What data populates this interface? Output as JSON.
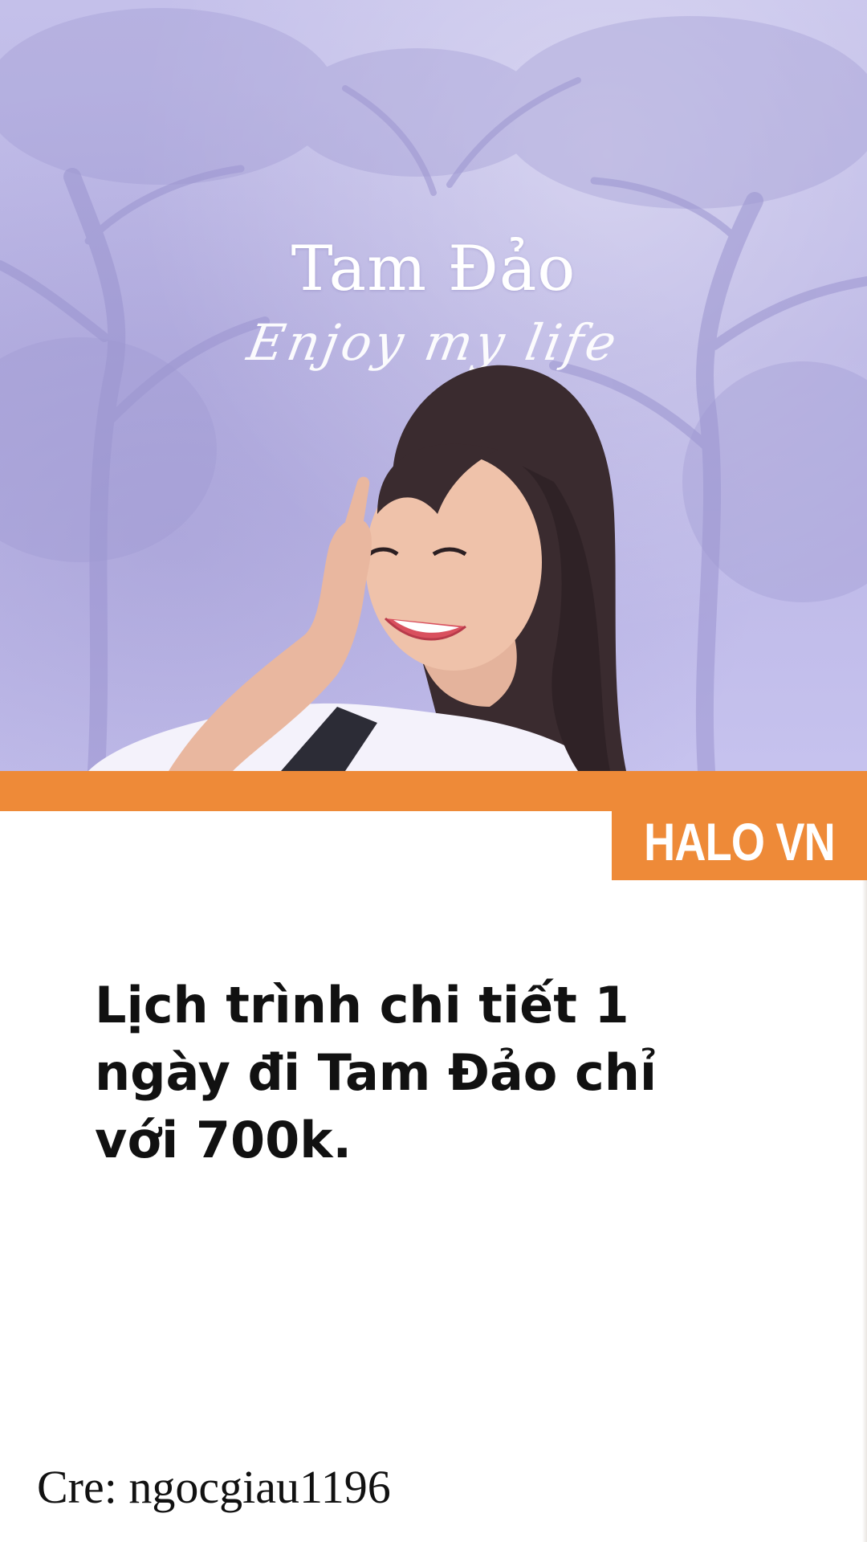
{
  "hero": {
    "title": "Tam Đảo",
    "subtitle": "Enjoy my life"
  },
  "brand": {
    "name": "HALO VN",
    "accent_color": "#ee8a38"
  },
  "headline": {
    "lines": [
      "Lịch trình chi tiết 1",
      "ngày đi Tam Đảo chỉ",
      "với 700k."
    ]
  },
  "credit": {
    "text": "Cre: ngocgiau1196"
  }
}
